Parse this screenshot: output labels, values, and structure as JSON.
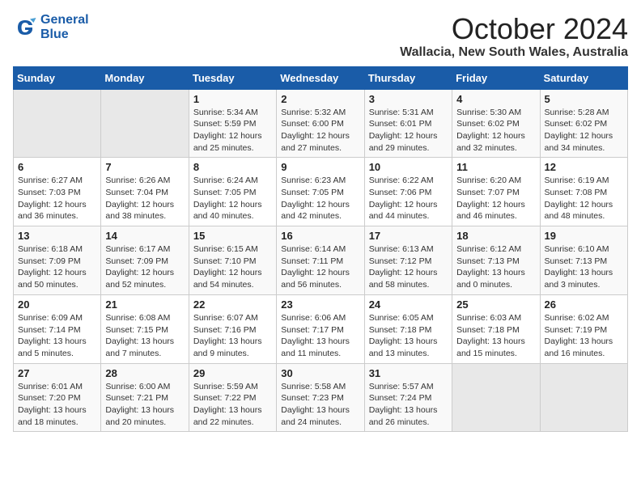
{
  "logo": {
    "general": "General",
    "blue": "Blue"
  },
  "header": {
    "month": "October 2024",
    "location": "Wallacia, New South Wales, Australia"
  },
  "days_of_week": [
    "Sunday",
    "Monday",
    "Tuesday",
    "Wednesday",
    "Thursday",
    "Friday",
    "Saturday"
  ],
  "weeks": [
    [
      {
        "day": "",
        "info": ""
      },
      {
        "day": "",
        "info": ""
      },
      {
        "day": "1",
        "info": "Sunrise: 5:34 AM\nSunset: 5:59 PM\nDaylight: 12 hours\nand 25 minutes."
      },
      {
        "day": "2",
        "info": "Sunrise: 5:32 AM\nSunset: 6:00 PM\nDaylight: 12 hours\nand 27 minutes."
      },
      {
        "day": "3",
        "info": "Sunrise: 5:31 AM\nSunset: 6:01 PM\nDaylight: 12 hours\nand 29 minutes."
      },
      {
        "day": "4",
        "info": "Sunrise: 5:30 AM\nSunset: 6:02 PM\nDaylight: 12 hours\nand 32 minutes."
      },
      {
        "day": "5",
        "info": "Sunrise: 5:28 AM\nSunset: 6:02 PM\nDaylight: 12 hours\nand 34 minutes."
      }
    ],
    [
      {
        "day": "6",
        "info": "Sunrise: 6:27 AM\nSunset: 7:03 PM\nDaylight: 12 hours\nand 36 minutes."
      },
      {
        "day": "7",
        "info": "Sunrise: 6:26 AM\nSunset: 7:04 PM\nDaylight: 12 hours\nand 38 minutes."
      },
      {
        "day": "8",
        "info": "Sunrise: 6:24 AM\nSunset: 7:05 PM\nDaylight: 12 hours\nand 40 minutes."
      },
      {
        "day": "9",
        "info": "Sunrise: 6:23 AM\nSunset: 7:05 PM\nDaylight: 12 hours\nand 42 minutes."
      },
      {
        "day": "10",
        "info": "Sunrise: 6:22 AM\nSunset: 7:06 PM\nDaylight: 12 hours\nand 44 minutes."
      },
      {
        "day": "11",
        "info": "Sunrise: 6:20 AM\nSunset: 7:07 PM\nDaylight: 12 hours\nand 46 minutes."
      },
      {
        "day": "12",
        "info": "Sunrise: 6:19 AM\nSunset: 7:08 PM\nDaylight: 12 hours\nand 48 minutes."
      }
    ],
    [
      {
        "day": "13",
        "info": "Sunrise: 6:18 AM\nSunset: 7:09 PM\nDaylight: 12 hours\nand 50 minutes."
      },
      {
        "day": "14",
        "info": "Sunrise: 6:17 AM\nSunset: 7:09 PM\nDaylight: 12 hours\nand 52 minutes."
      },
      {
        "day": "15",
        "info": "Sunrise: 6:15 AM\nSunset: 7:10 PM\nDaylight: 12 hours\nand 54 minutes."
      },
      {
        "day": "16",
        "info": "Sunrise: 6:14 AM\nSunset: 7:11 PM\nDaylight: 12 hours\nand 56 minutes."
      },
      {
        "day": "17",
        "info": "Sunrise: 6:13 AM\nSunset: 7:12 PM\nDaylight: 12 hours\nand 58 minutes."
      },
      {
        "day": "18",
        "info": "Sunrise: 6:12 AM\nSunset: 7:13 PM\nDaylight: 13 hours\nand 0 minutes."
      },
      {
        "day": "19",
        "info": "Sunrise: 6:10 AM\nSunset: 7:13 PM\nDaylight: 13 hours\nand 3 minutes."
      }
    ],
    [
      {
        "day": "20",
        "info": "Sunrise: 6:09 AM\nSunset: 7:14 PM\nDaylight: 13 hours\nand 5 minutes."
      },
      {
        "day": "21",
        "info": "Sunrise: 6:08 AM\nSunset: 7:15 PM\nDaylight: 13 hours\nand 7 minutes."
      },
      {
        "day": "22",
        "info": "Sunrise: 6:07 AM\nSunset: 7:16 PM\nDaylight: 13 hours\nand 9 minutes."
      },
      {
        "day": "23",
        "info": "Sunrise: 6:06 AM\nSunset: 7:17 PM\nDaylight: 13 hours\nand 11 minutes."
      },
      {
        "day": "24",
        "info": "Sunrise: 6:05 AM\nSunset: 7:18 PM\nDaylight: 13 hours\nand 13 minutes."
      },
      {
        "day": "25",
        "info": "Sunrise: 6:03 AM\nSunset: 7:18 PM\nDaylight: 13 hours\nand 15 minutes."
      },
      {
        "day": "26",
        "info": "Sunrise: 6:02 AM\nSunset: 7:19 PM\nDaylight: 13 hours\nand 16 minutes."
      }
    ],
    [
      {
        "day": "27",
        "info": "Sunrise: 6:01 AM\nSunset: 7:20 PM\nDaylight: 13 hours\nand 18 minutes."
      },
      {
        "day": "28",
        "info": "Sunrise: 6:00 AM\nSunset: 7:21 PM\nDaylight: 13 hours\nand 20 minutes."
      },
      {
        "day": "29",
        "info": "Sunrise: 5:59 AM\nSunset: 7:22 PM\nDaylight: 13 hours\nand 22 minutes."
      },
      {
        "day": "30",
        "info": "Sunrise: 5:58 AM\nSunset: 7:23 PM\nDaylight: 13 hours\nand 24 minutes."
      },
      {
        "day": "31",
        "info": "Sunrise: 5:57 AM\nSunset: 7:24 PM\nDaylight: 13 hours\nand 26 minutes."
      },
      {
        "day": "",
        "info": ""
      },
      {
        "day": "",
        "info": ""
      }
    ]
  ]
}
